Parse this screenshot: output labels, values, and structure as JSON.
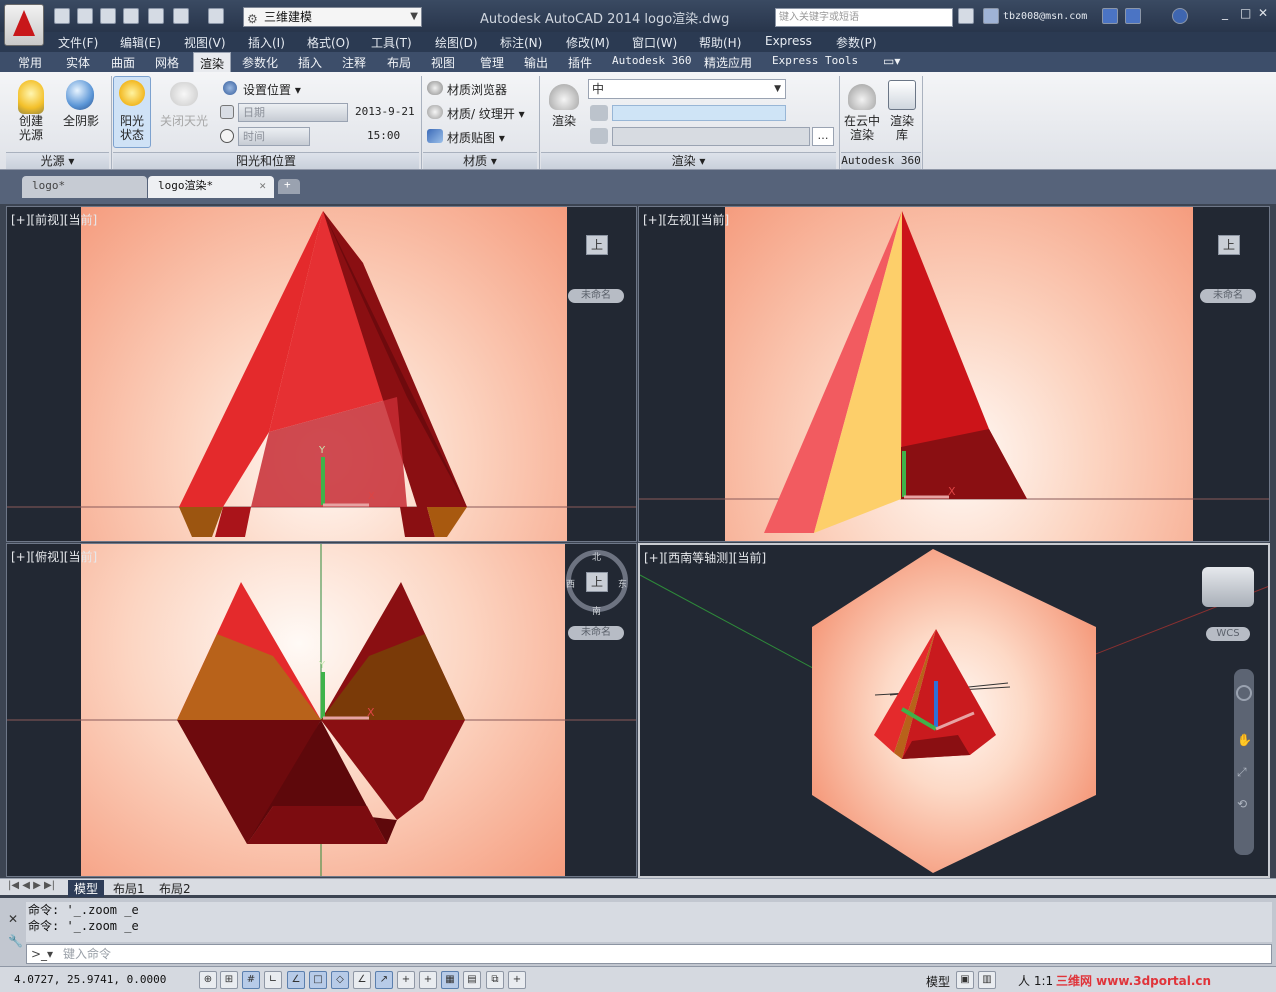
{
  "app": {
    "title": "Autodesk AutoCAD 2014    logo渲染.dwg",
    "workspace": "三维建模",
    "search_placeholder": "键入关键字或短语",
    "user": "tbz008@msn.com"
  },
  "menu": [
    "文件(F)",
    "编辑(E)",
    "视图(V)",
    "插入(I)",
    "格式(O)",
    "工具(T)",
    "绘图(D)",
    "标注(N)",
    "修改(M)",
    "窗口(W)",
    "帮助(H)",
    "Express",
    "参数(P)"
  ],
  "ribbon_tabs": [
    "常用",
    "实体",
    "曲面",
    "网格",
    "渲染",
    "参数化",
    "插入",
    "注释",
    "布局",
    "视图",
    "管理",
    "输出",
    "插件",
    "Autodesk 360",
    "精选应用",
    "Express Tools"
  ],
  "ribbon_active_tab": "渲染",
  "ribbon": {
    "lights": {
      "create_light": "创建\n光源",
      "full_shadow": "全阴影",
      "title": "光源"
    },
    "sun": {
      "sun_status": "阳光\n状态",
      "sky_off": "关闭天光",
      "set_location": "设置位置",
      "date_placeholder": "日期",
      "date_value": "2013-9-21",
      "time_placeholder": "时间",
      "time_value": "15:00",
      "title": "阳光和位置"
    },
    "materials": {
      "browser": "材质浏览器",
      "material_texture": "材质/ 纹理开",
      "material_map": "材质贴图",
      "title": "材质"
    },
    "render": {
      "render": "渲染",
      "quality": "中",
      "title": "渲染"
    },
    "cloud": {
      "render_in_cloud": "在云中\n渲染",
      "render_gallery": "渲染\n库",
      "title": "Autodesk 360"
    }
  },
  "doc_tabs": [
    {
      "label": "logo*",
      "active": false
    },
    {
      "label": "logo渲染*",
      "active": true
    }
  ],
  "viewports": {
    "front": "[+][前视][当前]",
    "left": "[+][左视][当前]",
    "top": "[+][俯视][当前]",
    "sw_iso": "[+][西南等轴测][当前]"
  },
  "viewcube": {
    "unnamed": "未命名",
    "wcs": "WCS",
    "north": "北",
    "south": "南",
    "east": "东",
    "west": "西",
    "face_label": "上"
  },
  "layout_tabs": [
    "模型",
    "布局1",
    "布局2"
  ],
  "command": {
    "history": [
      "命令: '_.zoom _e",
      "命令: '_.zoom _e"
    ],
    "placeholder": "键入命令"
  },
  "status": {
    "coords": "4.0727,  25.9741, 0.0000",
    "model": "模型",
    "scale": "1:1",
    "watermark": "三维网 www.3dportal.cn"
  },
  "colors": {
    "render_red": "#e42a2c",
    "dark_red": "#8a0f12",
    "orange": "#b8621a",
    "yellow": "#fdcf6a",
    "background_peach": "#f7a98c"
  }
}
